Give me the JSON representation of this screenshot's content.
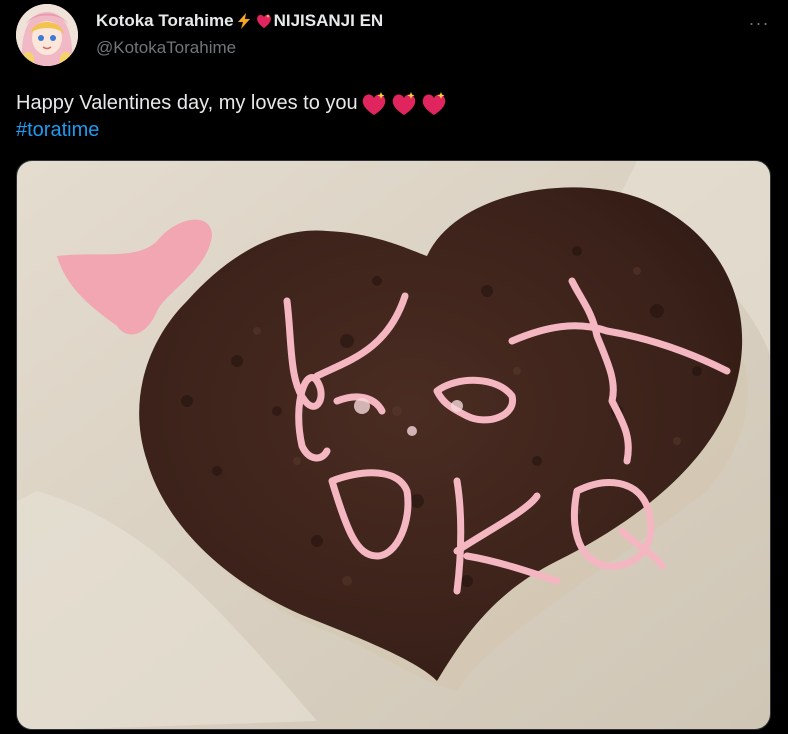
{
  "author": {
    "display_name": "Kotoka Torahime",
    "name_suffix": "NIJISANJI EN",
    "handle": "@KotokaTorahime",
    "avatar_icon": "avatar-image",
    "name_emojis": [
      "lightning-emoji",
      "sparkling-heart-emoji"
    ]
  },
  "menu": {
    "more_label": "···"
  },
  "tweet": {
    "text": "Happy Valentines day, my loves to you",
    "text_emojis": [
      "sparkling-heart-emoji",
      "sparkling-heart-emoji",
      "sparkling-heart-emoji"
    ],
    "hashtag": "#toratime"
  },
  "media": {
    "image_icon": "chocolate-heart-photo"
  },
  "colors": {
    "background": "#000000",
    "text": "#e7e9ea",
    "secondary": "#71767b",
    "link": "#1d9bf0"
  }
}
